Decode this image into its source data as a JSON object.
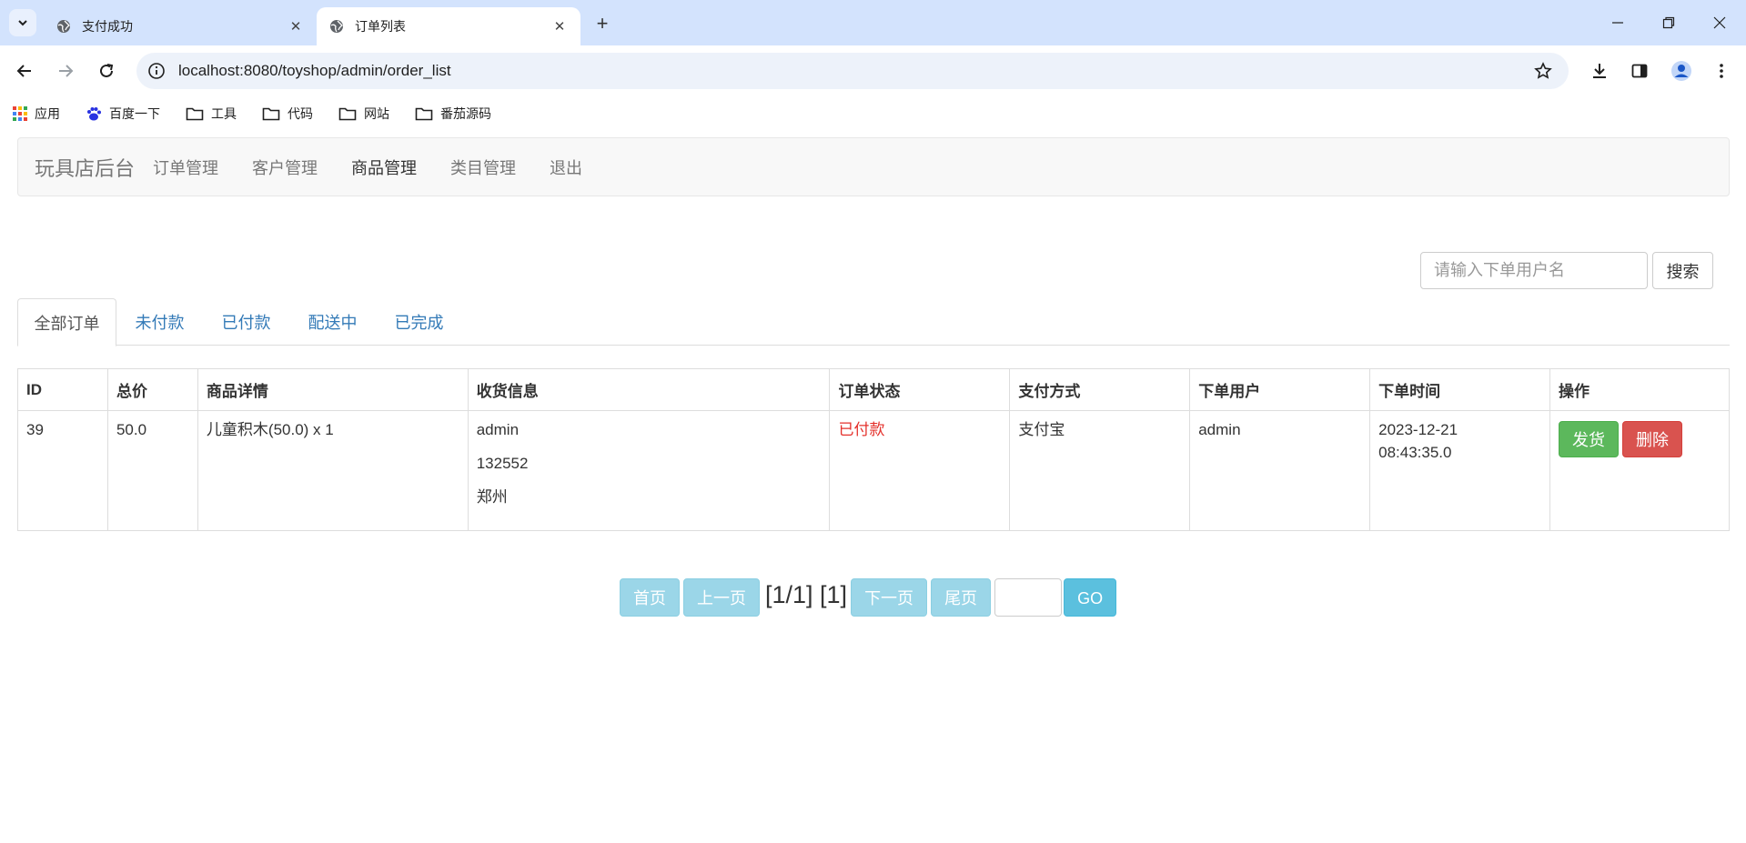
{
  "browser": {
    "tabs": [
      {
        "title": "支付成功",
        "active": false
      },
      {
        "title": "订单列表",
        "active": true
      }
    ],
    "url": "localhost:8080/toyshop/admin/order_list",
    "bookmarks": [
      "应用",
      "百度一下",
      "工具",
      "代码",
      "网站",
      "番茄源码"
    ]
  },
  "navbar": {
    "brand": "玩具店后台",
    "links": [
      "订单管理",
      "客户管理",
      "商品管理",
      "类目管理",
      "退出"
    ]
  },
  "search": {
    "placeholder": "请输入下单用户名",
    "button": "搜索"
  },
  "status_tabs": [
    "全部订单",
    "未付款",
    "已付款",
    "配送中",
    "已完成"
  ],
  "table": {
    "headers": [
      "ID",
      "总价",
      "商品详情",
      "收货信息",
      "订单状态",
      "支付方式",
      "下单用户",
      "下单时间",
      "操作"
    ],
    "rows": [
      {
        "id": "39",
        "total": "50.0",
        "items": "儿童积木(50.0) x 1",
        "receiver_name": "admin",
        "receiver_phone": "132552",
        "receiver_address": "郑州",
        "status": "已付款",
        "payment": "支付宝",
        "user": "admin",
        "time_date": "2023-12-21",
        "time_clock": "08:43:35.0",
        "action_ship": "发货",
        "action_delete": "删除"
      }
    ]
  },
  "pager": {
    "first": "首页",
    "prev": "上一页",
    "info": "[1/1] [1]",
    "next": "下一页",
    "last": "尾页",
    "go": "GO"
  },
  "colors": {
    "status_paid": "#e4302b",
    "link": "#337ab7",
    "ship_button": "#5cb85c",
    "delete_button": "#d9534f",
    "pager_disabled": "#9bd6e8",
    "go_button": "#5bc0de"
  }
}
